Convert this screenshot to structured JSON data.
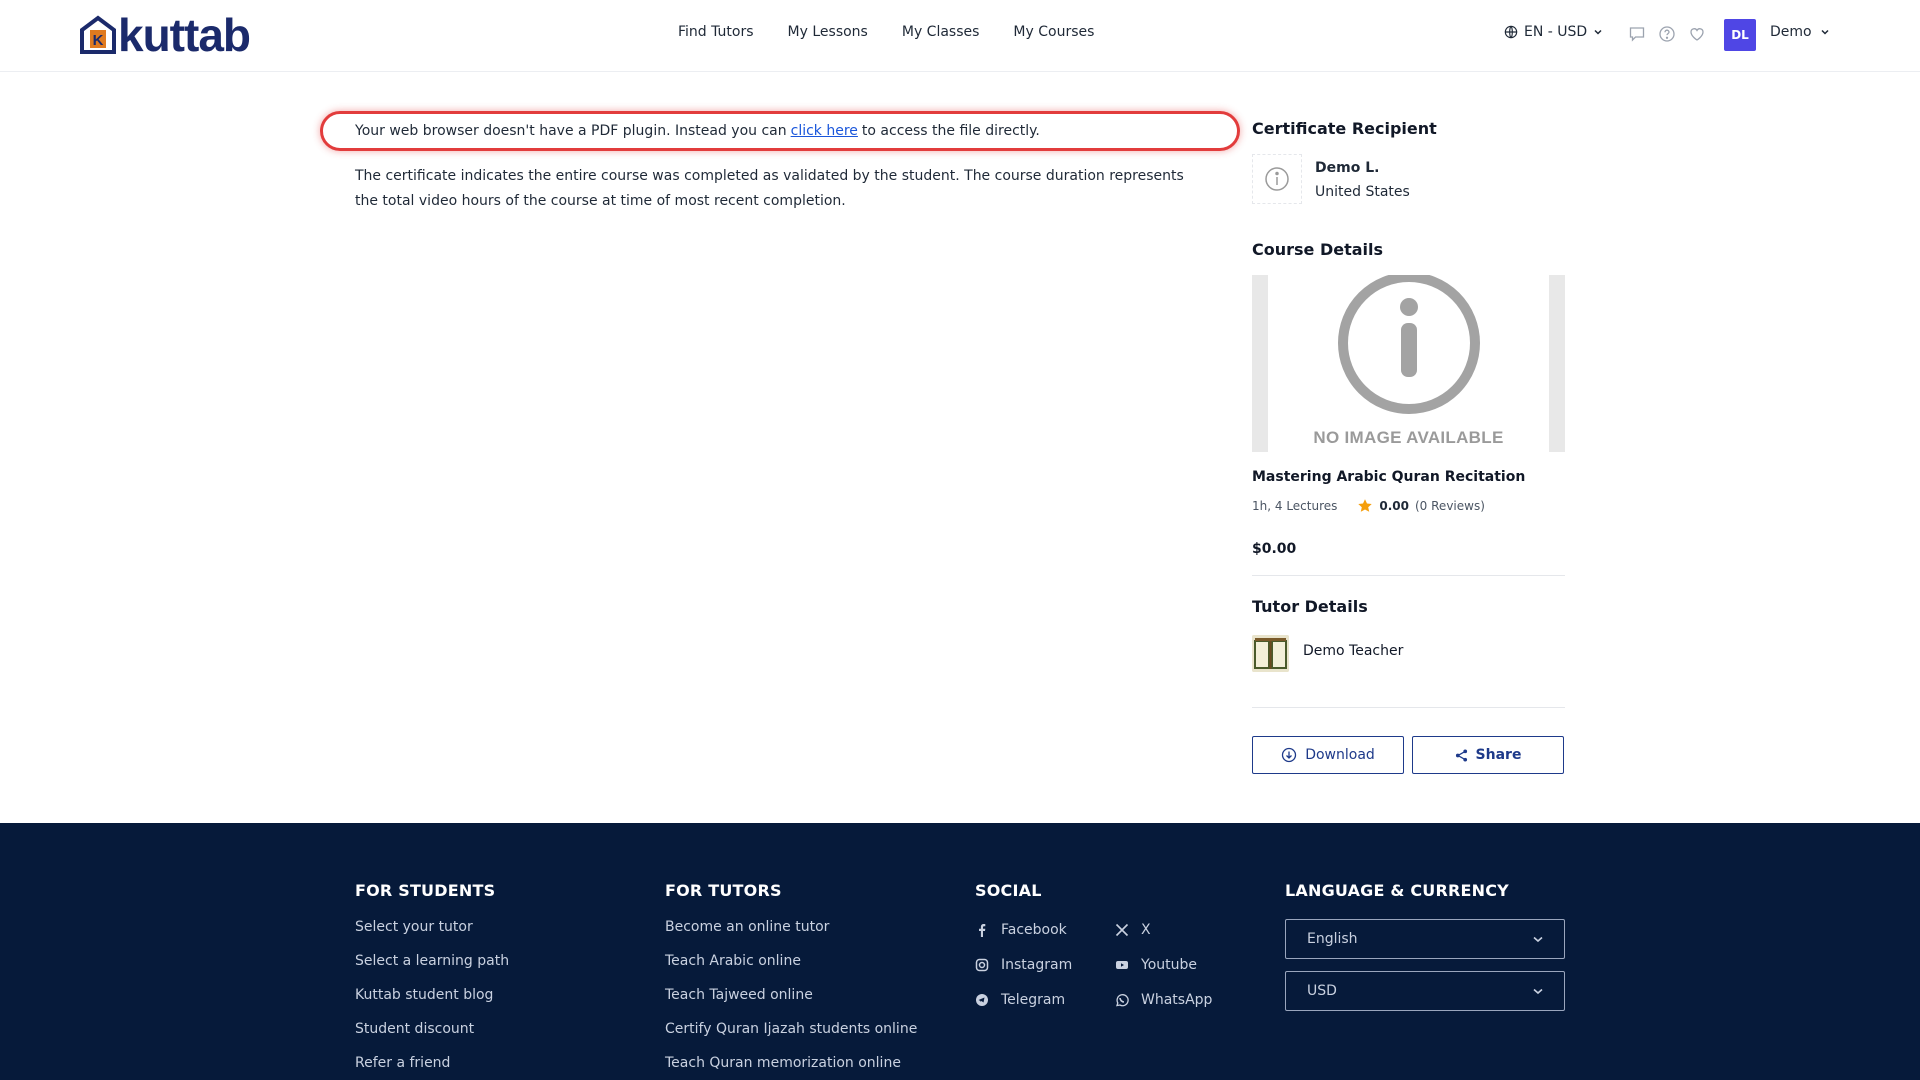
{
  "header": {
    "logo_text": "kuttab",
    "nav": [
      "Find Tutors",
      "My Lessons",
      "My Classes",
      "My Courses"
    ],
    "locale": "EN - USD",
    "user": {
      "initials": "DL",
      "name": "Demo"
    },
    "colors": {
      "brand": "#1b2a6b",
      "avatar": "#4f46e5"
    }
  },
  "main": {
    "pdf_notice": {
      "before": "Your web browser doesn't have a PDF plugin. Instead you can",
      "link": "click here",
      "after": "to access the file directly."
    },
    "description": "The certificate indicates the entire course was completed as validated by the student. The course duration represents the total video hours of the course at time of most recent completion."
  },
  "sidebar": {
    "recipient_heading": "Certificate Recipient",
    "recipient": {
      "name": "Demo L.",
      "country": "United States"
    },
    "course_heading": "Course Details",
    "course": {
      "image_placeholder": "NO IMAGE AVAILABLE",
      "title": "Mastering Arabic Quran Recitation",
      "meta": "1h, 4 Lectures",
      "rating": "0.00",
      "reviews": "(0 Reviews)",
      "price": "$0.00"
    },
    "tutor_heading": "Tutor Details",
    "tutor": {
      "name": "Demo Teacher"
    },
    "download_label": "Download",
    "share_label": "Share"
  },
  "footer": {
    "students": {
      "heading": "FOR STUDENTS",
      "links": [
        "Select your tutor",
        "Select a learning path",
        "Kuttab student blog",
        "Student discount",
        "Refer a friend"
      ]
    },
    "tutors": {
      "heading": "FOR TUTORS",
      "links": [
        "Become an online tutor",
        "Teach Arabic online",
        "Teach Tajweed online",
        "Certify Quran Ijazah students online",
        "Teach Quran memorization online"
      ]
    },
    "social": {
      "heading": "SOCIAL",
      "links": [
        "Facebook",
        "X",
        "Instagram",
        "Youtube",
        "Telegram",
        "WhatsApp"
      ]
    },
    "lang": {
      "heading": "LANGUAGE & CURRENCY",
      "language": "English",
      "currency": "USD"
    },
    "colors": {
      "background": "#061a3a"
    }
  }
}
